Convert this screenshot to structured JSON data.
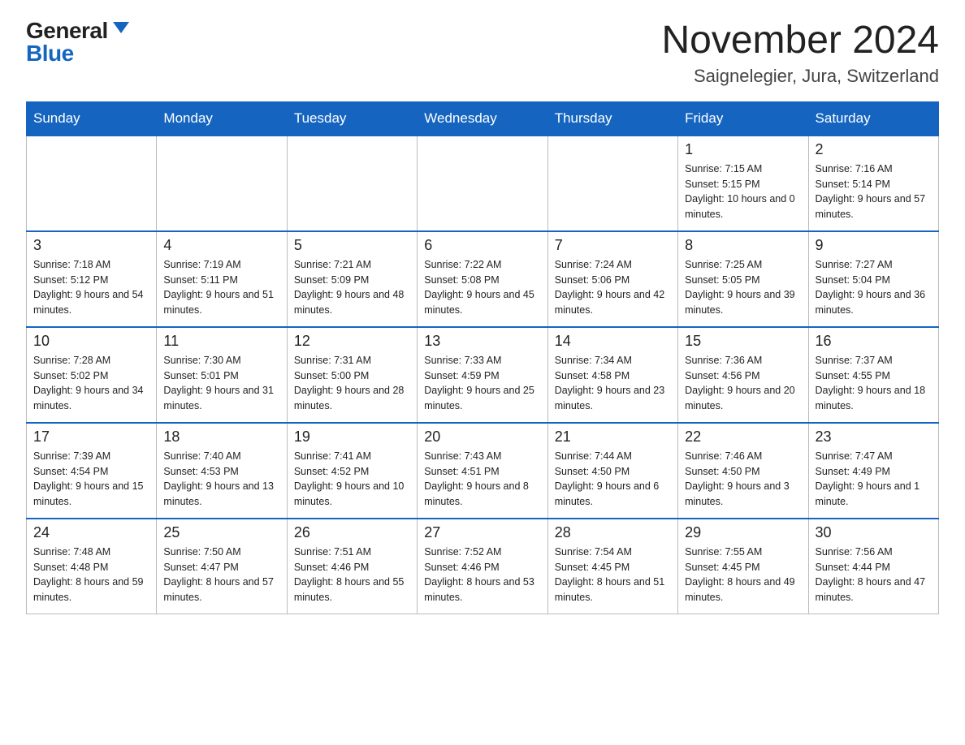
{
  "logo": {
    "general": "General",
    "blue": "Blue"
  },
  "title": "November 2024",
  "location": "Saignelegier, Jura, Switzerland",
  "days_of_week": [
    "Sunday",
    "Monday",
    "Tuesday",
    "Wednesday",
    "Thursday",
    "Friday",
    "Saturday"
  ],
  "weeks": [
    [
      {
        "day": "",
        "empty": true
      },
      {
        "day": "",
        "empty": true
      },
      {
        "day": "",
        "empty": true
      },
      {
        "day": "",
        "empty": true
      },
      {
        "day": "",
        "empty": true
      },
      {
        "day": "1",
        "sunrise": "7:15 AM",
        "sunset": "5:15 PM",
        "daylight": "10 hours and 0 minutes."
      },
      {
        "day": "2",
        "sunrise": "7:16 AM",
        "sunset": "5:14 PM",
        "daylight": "9 hours and 57 minutes."
      }
    ],
    [
      {
        "day": "3",
        "sunrise": "7:18 AM",
        "sunset": "5:12 PM",
        "daylight": "9 hours and 54 minutes."
      },
      {
        "day": "4",
        "sunrise": "7:19 AM",
        "sunset": "5:11 PM",
        "daylight": "9 hours and 51 minutes."
      },
      {
        "day": "5",
        "sunrise": "7:21 AM",
        "sunset": "5:09 PM",
        "daylight": "9 hours and 48 minutes."
      },
      {
        "day": "6",
        "sunrise": "7:22 AM",
        "sunset": "5:08 PM",
        "daylight": "9 hours and 45 minutes."
      },
      {
        "day": "7",
        "sunrise": "7:24 AM",
        "sunset": "5:06 PM",
        "daylight": "9 hours and 42 minutes."
      },
      {
        "day": "8",
        "sunrise": "7:25 AM",
        "sunset": "5:05 PM",
        "daylight": "9 hours and 39 minutes."
      },
      {
        "day": "9",
        "sunrise": "7:27 AM",
        "sunset": "5:04 PM",
        "daylight": "9 hours and 36 minutes."
      }
    ],
    [
      {
        "day": "10",
        "sunrise": "7:28 AM",
        "sunset": "5:02 PM",
        "daylight": "9 hours and 34 minutes."
      },
      {
        "day": "11",
        "sunrise": "7:30 AM",
        "sunset": "5:01 PM",
        "daylight": "9 hours and 31 minutes."
      },
      {
        "day": "12",
        "sunrise": "7:31 AM",
        "sunset": "5:00 PM",
        "daylight": "9 hours and 28 minutes."
      },
      {
        "day": "13",
        "sunrise": "7:33 AM",
        "sunset": "4:59 PM",
        "daylight": "9 hours and 25 minutes."
      },
      {
        "day": "14",
        "sunrise": "7:34 AM",
        "sunset": "4:58 PM",
        "daylight": "9 hours and 23 minutes."
      },
      {
        "day": "15",
        "sunrise": "7:36 AM",
        "sunset": "4:56 PM",
        "daylight": "9 hours and 20 minutes."
      },
      {
        "day": "16",
        "sunrise": "7:37 AM",
        "sunset": "4:55 PM",
        "daylight": "9 hours and 18 minutes."
      }
    ],
    [
      {
        "day": "17",
        "sunrise": "7:39 AM",
        "sunset": "4:54 PM",
        "daylight": "9 hours and 15 minutes."
      },
      {
        "day": "18",
        "sunrise": "7:40 AM",
        "sunset": "4:53 PM",
        "daylight": "9 hours and 13 minutes."
      },
      {
        "day": "19",
        "sunrise": "7:41 AM",
        "sunset": "4:52 PM",
        "daylight": "9 hours and 10 minutes."
      },
      {
        "day": "20",
        "sunrise": "7:43 AM",
        "sunset": "4:51 PM",
        "daylight": "9 hours and 8 minutes."
      },
      {
        "day": "21",
        "sunrise": "7:44 AM",
        "sunset": "4:50 PM",
        "daylight": "9 hours and 6 minutes."
      },
      {
        "day": "22",
        "sunrise": "7:46 AM",
        "sunset": "4:50 PM",
        "daylight": "9 hours and 3 minutes."
      },
      {
        "day": "23",
        "sunrise": "7:47 AM",
        "sunset": "4:49 PM",
        "daylight": "9 hours and 1 minute."
      }
    ],
    [
      {
        "day": "24",
        "sunrise": "7:48 AM",
        "sunset": "4:48 PM",
        "daylight": "8 hours and 59 minutes."
      },
      {
        "day": "25",
        "sunrise": "7:50 AM",
        "sunset": "4:47 PM",
        "daylight": "8 hours and 57 minutes."
      },
      {
        "day": "26",
        "sunrise": "7:51 AM",
        "sunset": "4:46 PM",
        "daylight": "8 hours and 55 minutes."
      },
      {
        "day": "27",
        "sunrise": "7:52 AM",
        "sunset": "4:46 PM",
        "daylight": "8 hours and 53 minutes."
      },
      {
        "day": "28",
        "sunrise": "7:54 AM",
        "sunset": "4:45 PM",
        "daylight": "8 hours and 51 minutes."
      },
      {
        "day": "29",
        "sunrise": "7:55 AM",
        "sunset": "4:45 PM",
        "daylight": "8 hours and 49 minutes."
      },
      {
        "day": "30",
        "sunrise": "7:56 AM",
        "sunset": "4:44 PM",
        "daylight": "8 hours and 47 minutes."
      }
    ]
  ]
}
